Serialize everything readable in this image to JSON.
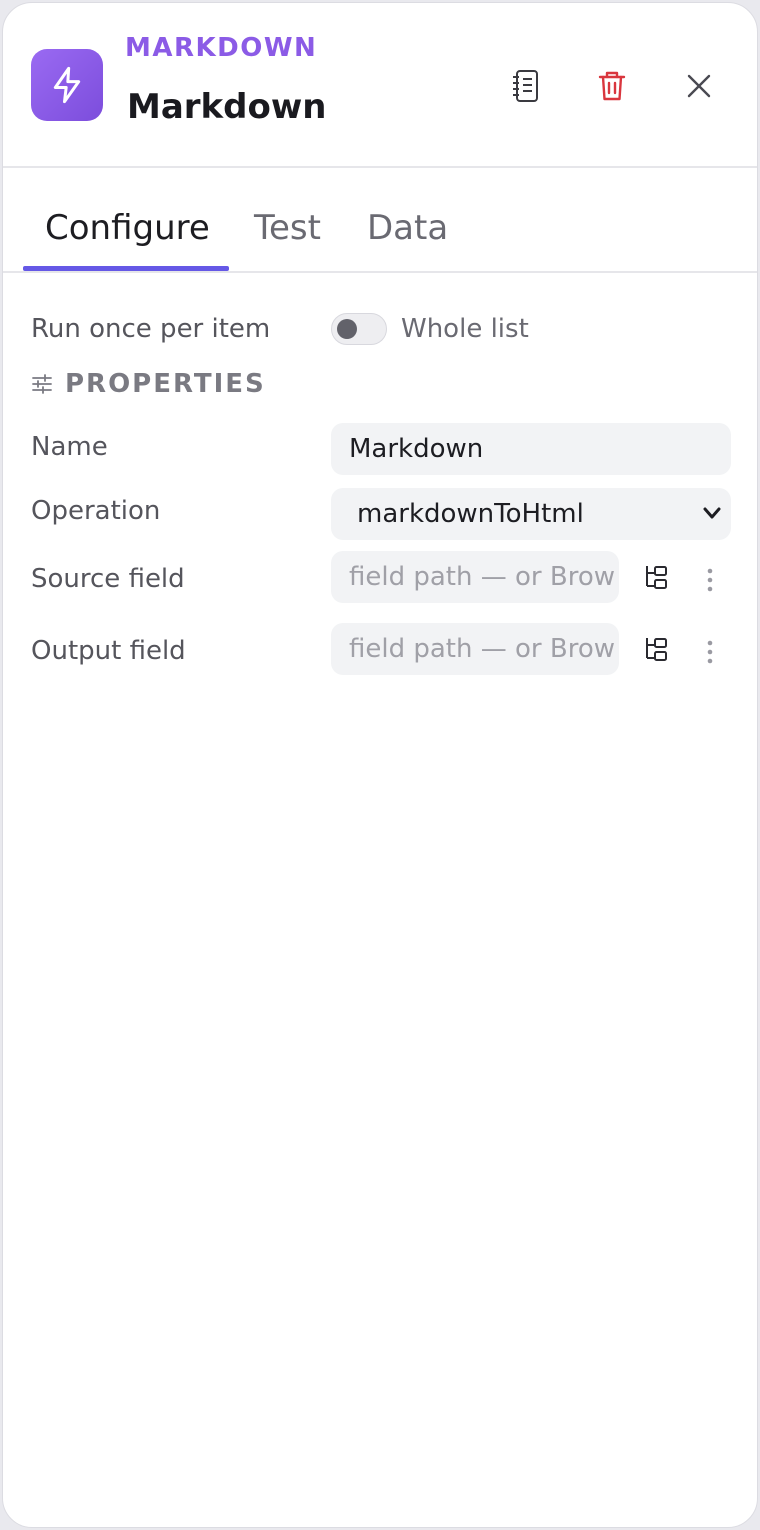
{
  "header": {
    "kind_label": "MARKDOWN",
    "title": "Markdown",
    "app_icon": "lightning-icon",
    "actions": {
      "notes_icon": "notebook-icon",
      "delete_icon": "trash-icon",
      "close_icon": "close-icon"
    },
    "accent_color": "#8b5be6",
    "delete_color": "#d9363e"
  },
  "tabs": [
    {
      "label": "Configure",
      "active": true
    },
    {
      "label": "Test",
      "active": false
    },
    {
      "label": "Data",
      "active": false
    }
  ],
  "config": {
    "run_mode_label": "Run once per item",
    "toggle_label": "Whole list",
    "toggle_on": false,
    "section_title": "PROPERTIES",
    "section_icon": "sliders-icon",
    "fields": {
      "name": {
        "label": "Name",
        "value": "Markdown"
      },
      "operation": {
        "label": "Operation",
        "value": "markdownToHtml"
      },
      "source": {
        "label": "Source field",
        "placeholder": "field path — or Brow"
      },
      "output": {
        "label": "Output field",
        "placeholder": "field path — or Brow"
      }
    }
  }
}
